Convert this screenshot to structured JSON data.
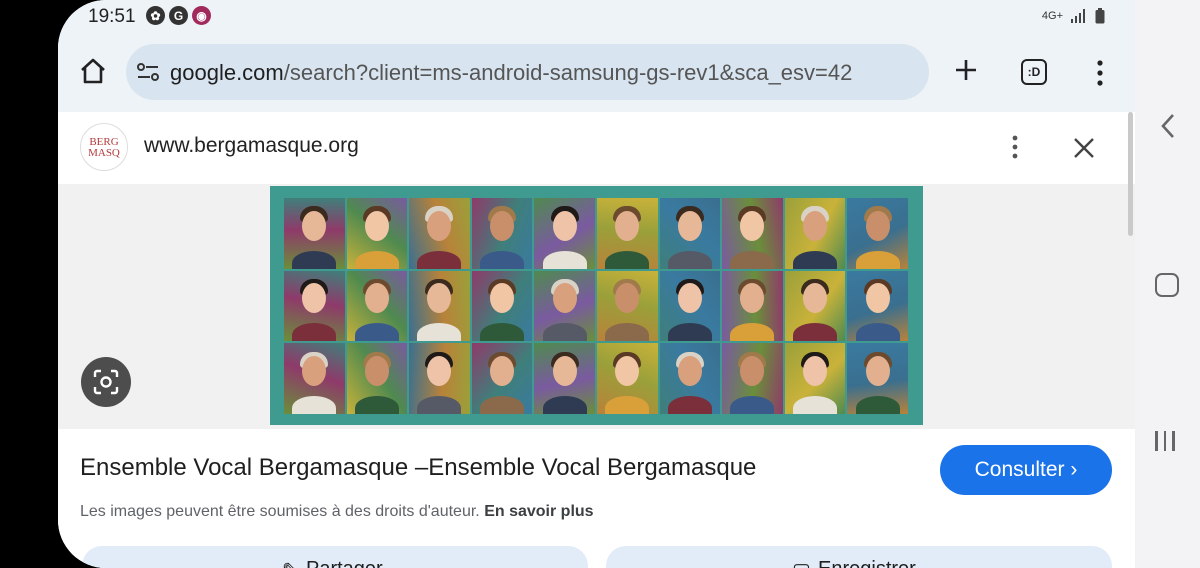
{
  "status_bar": {
    "time": "19:51",
    "network": "4G+"
  },
  "browser": {
    "url_host": "google.com",
    "url_path": "/search?client=ms-android-samsung-gs-rev1&sca_esv=42",
    "tabs_icon_label": ":D"
  },
  "result": {
    "site_url": "www.bergamasque.org",
    "favicon_text": "BERG MASQ",
    "title": "Ensemble Vocal Bergamasque –Ensemble Vocal Bergamasque",
    "consult_label": "Consulter ›",
    "copyright_note": "Les images peuvent être soumises à des droits d'auteur.",
    "learn_more": "En savoir plus",
    "share_label": "Partager",
    "save_label": "Enregistrer"
  },
  "colors": {
    "accent": "#1a73e8",
    "photo_border": "#3f9a8f",
    "urlbar": "#d8e4ef"
  }
}
